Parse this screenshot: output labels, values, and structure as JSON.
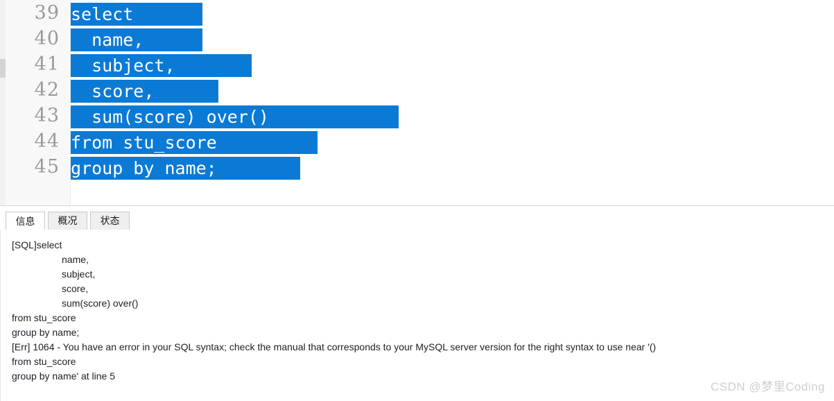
{
  "editor": {
    "scrollbar": {
      "name": "vertical-scrollbar"
    },
    "lines": [
      {
        "number": "39",
        "text": "select",
        "highlight_width": 190
      },
      {
        "number": "40",
        "text": "  name,",
        "highlight_width": 190
      },
      {
        "number": "41",
        "text": "  subject,",
        "highlight_width": 261
      },
      {
        "number": "42",
        "text": "  score,",
        "highlight_width": 213
      },
      {
        "number": "43",
        "text": "  sum(score) over()",
        "highlight_width": 473
      },
      {
        "number": "44",
        "text": "from stu_score",
        "highlight_width": 356
      },
      {
        "number": "45",
        "text": "group by name;",
        "highlight_width": 331
      }
    ]
  },
  "result": {
    "tabs": [
      {
        "label": "信息",
        "active": true
      },
      {
        "label": "概况",
        "active": false
      },
      {
        "label": "状态",
        "active": false
      }
    ],
    "log": [
      {
        "text": "[SQL]select",
        "indent": false
      },
      {
        "text": "name,",
        "indent": true
      },
      {
        "text": "subject,",
        "indent": true
      },
      {
        "text": "score,",
        "indent": true
      },
      {
        "text": "sum(score) over()",
        "indent": true
      },
      {
        "text": "from stu_score",
        "indent": false
      },
      {
        "text": "group by name;",
        "indent": false
      },
      {
        "text": "[Err] 1064 - You have an error in your SQL syntax; check the manual that corresponds to your MySQL server version for the right syntax to use near '()",
        "indent": false
      },
      {
        "text": "from stu_score",
        "indent": false
      },
      {
        "text": "group by name' at line 5",
        "indent": false
      }
    ]
  },
  "watermark": {
    "text": "CSDN @梦里Coding"
  },
  "colors": {
    "selection_blue": "#0b7ad5",
    "selection_text": "#ffffff",
    "line_number": "#9a9a9a",
    "log_text": "#20202a",
    "watermark": "#cfcfcf"
  }
}
